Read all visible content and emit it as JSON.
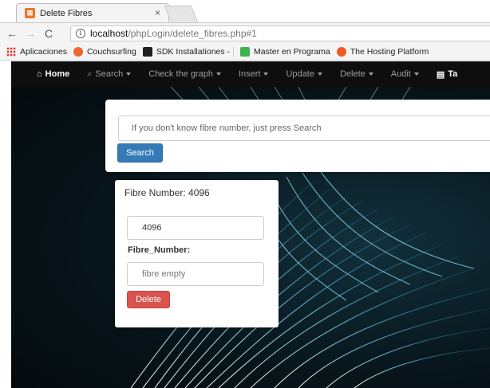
{
  "browser": {
    "tab_title": "Delete Fibres",
    "tab_close": "×",
    "favicon_glyph": "⊠",
    "url_host": "localhost",
    "url_path": "/phpLogin/delete_fibres.php#1",
    "bookmarks": [
      {
        "label": "Aplicaciones",
        "icon": "apps-grid-icon",
        "color": "#e53935"
      },
      {
        "label": "Couchsurfing",
        "icon": "couchsurfing-icon",
        "color": "#f0642d"
      },
      {
        "label": "SDK Installationes -",
        "icon": "sdk-icon",
        "color": "#1f1f1f"
      },
      {
        "label": "Master en Programa",
        "icon": "udemy-icon",
        "color": "#3fb34f"
      },
      {
        "label": "The Hosting Platform",
        "icon": "hosting-icon",
        "color": "#ef5a22"
      }
    ]
  },
  "navbar": {
    "home": "Home",
    "items": [
      {
        "label": "Search",
        "icon": "search-icon"
      },
      {
        "label": "Check the graph"
      },
      {
        "label": "Insert"
      },
      {
        "label": "Update"
      },
      {
        "label": "Delete"
      },
      {
        "label": "Audit"
      },
      {
        "label": "Ta",
        "icon": "print-icon"
      }
    ]
  },
  "search_panel": {
    "placeholder": "If you don't know fibre number, just press Search",
    "button": "Search"
  },
  "result_panel": {
    "title": "Fibre Number: 4096",
    "number_value": "4096",
    "field_label": "Fibre_Number:",
    "field_placeholder": "fibre empty",
    "delete_button": "Delete"
  },
  "colors": {
    "primary": "#337ab7",
    "danger": "#d9534f",
    "navbar": "#0f0f0f"
  }
}
